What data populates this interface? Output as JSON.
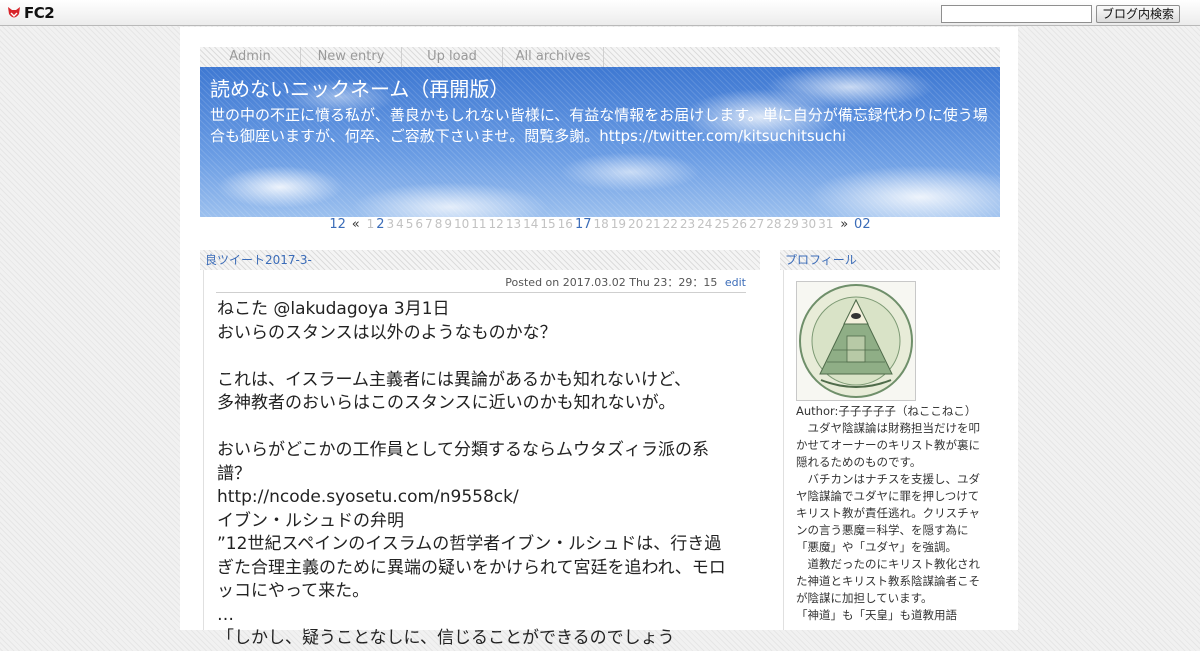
{
  "fc2": {
    "logo_text": "FC2",
    "search_placeholder": "",
    "search_button": "ブログ内検索"
  },
  "nav": {
    "items": [
      "Admin",
      "New entry",
      "Up load",
      "All archives"
    ]
  },
  "header": {
    "title": "読めないニックネーム（再開版）",
    "description": "世の中の不正に憤る私が、善良かもしれない皆様に、有益な情報をお届けします。単に自分が備忘録代わりに使う場合も御座いますが、何卒、ご容赦下さいませ。閲覧多謝。https://twitter.com/kitsuchitsuchi"
  },
  "calendar": {
    "prev_month": "12",
    "prev_arrow": "«",
    "days": [
      "1",
      "2",
      "3",
      "4",
      "5",
      "6",
      "7",
      "8",
      "9",
      "10",
      "11",
      "12",
      "13",
      "14",
      "15",
      "16",
      "17",
      "18",
      "19",
      "20",
      "21",
      "22",
      "23",
      "24",
      "25",
      "26",
      "27",
      "28",
      "29",
      "30",
      "31"
    ],
    "active_days": [
      "2",
      "17"
    ],
    "next_arrow": "»",
    "next_month": "02"
  },
  "entry": {
    "title": "良ツイート2017-3-",
    "posted": "Posted on 2017.03.02 Thu 23：29：15",
    "edit_label": "edit",
    "lines": [
      "ねこた @lakudagoya 3月1日",
      "おいらのスタンスは以外のようなものかな？",
      "",
      "これは、イスラーム主義者には異論があるかも知れないけど、",
      "多神教者のおいらはこのスタンスに近いのかも知れないが。",
      "",
      "おいらがどこかの工作員として分類するならムウタズィラ派の系譜？",
      "http://ncode.syosetu.com/n9558ck/",
      "イブン・ルシュドの弁明",
      "”12世紀スペインのイスラムの哲学者イブン・ルシュドは、行き過ぎた合理主義のために異端の疑いをかけられて宮廷を追われ、モロッコにやって来た。",
      "…",
      "「しかし、疑うことなしに、信じることができるのでしょう"
    ]
  },
  "sidebar": {
    "profile_title": "プロフィール",
    "author": "Author:子子子子子（ねここねこ）",
    "paragraphs": [
      "　ユダヤ陰謀論は財務担当だけを叩かせてオーナーのキリスト教が裏に隠れるためのものです。",
      "　バチカンはナチスを支援し、ユダヤ陰謀論でユダヤに罪を押しつけてキリスト教が責任逃れ。クリスチャンの言う悪魔＝科学、を隠す為に「悪魔」や「ユダヤ」を強調。",
      "　道教だったのにキリスト教化された神道とキリスト教系陰謀論者こそが陰謀に加担しています。",
      "「神道」も「天皇」も道教用語"
    ]
  }
}
